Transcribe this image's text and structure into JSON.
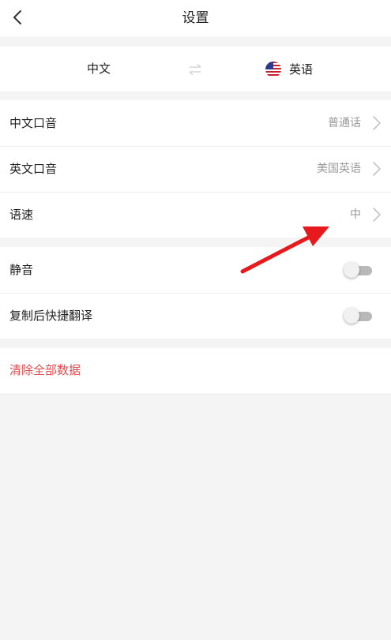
{
  "header": {
    "title": "设置",
    "back_icon": "chevron-left-icon"
  },
  "language_bar": {
    "source": "中文",
    "swap_icon": "swap-arrows-icon",
    "target": "英语",
    "target_flag_icon": "us-flag-icon"
  },
  "voice_settings": [
    {
      "label": "中文口音",
      "value": "普通话"
    },
    {
      "label": "英文口音",
      "value": "美国英语"
    },
    {
      "label": "语速",
      "value": "中"
    }
  ],
  "toggles": [
    {
      "label": "静音",
      "state": "off"
    },
    {
      "label": "复制后快捷翻译",
      "state": "off"
    }
  ],
  "danger": {
    "clear_label": "清除全部数据"
  },
  "colors": {
    "background": "#f4f4f4",
    "accent_red": "#e8474a",
    "muted_text": "#999999",
    "annotation_arrow": "#e8191c"
  }
}
